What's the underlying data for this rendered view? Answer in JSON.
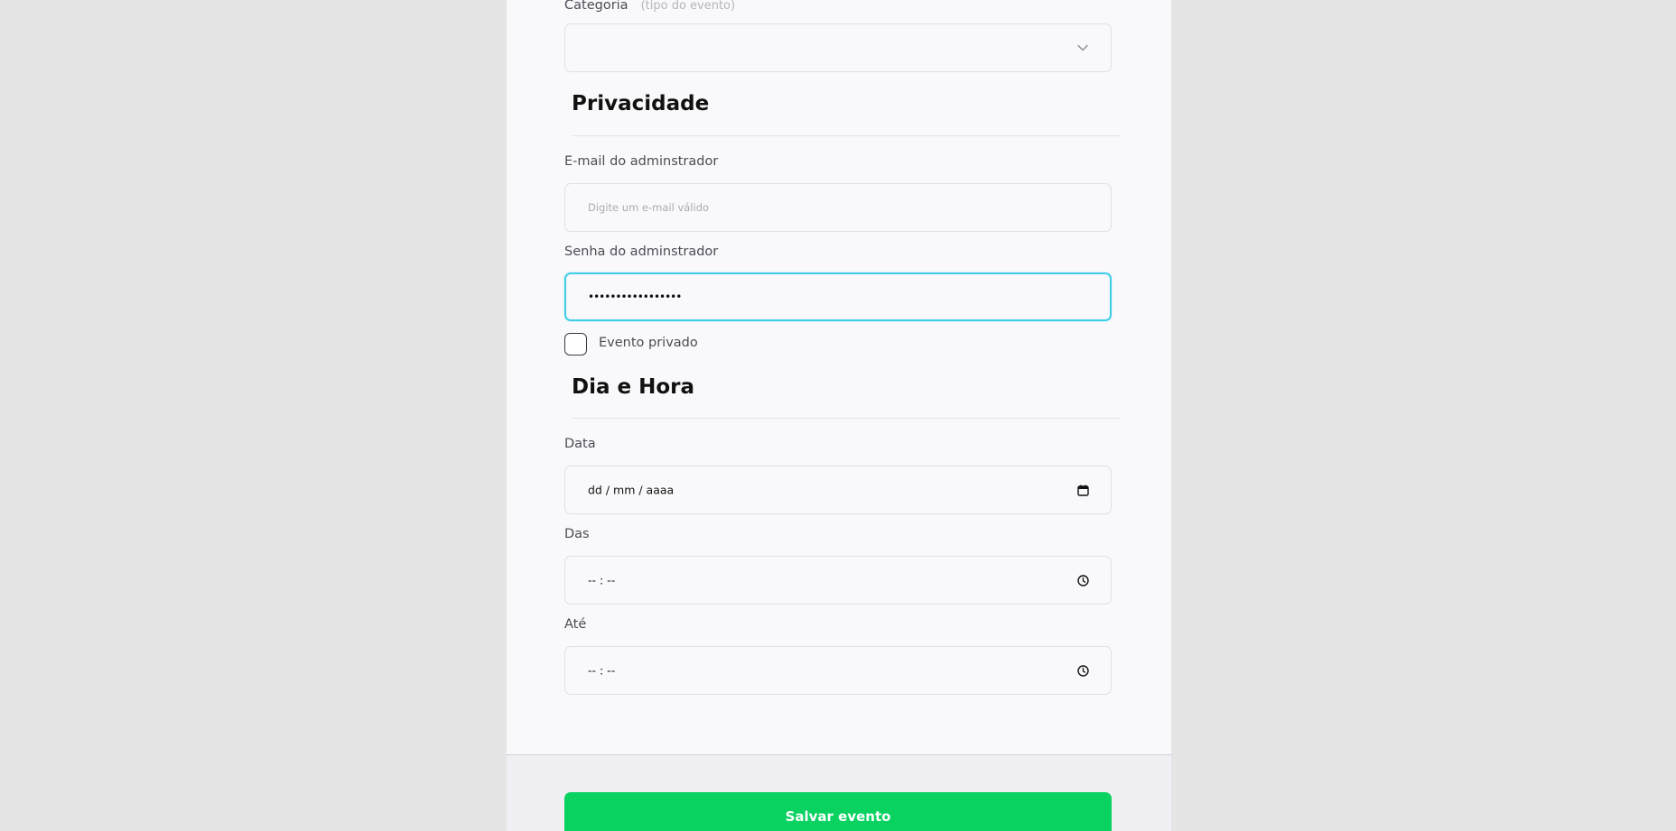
{
  "form": {
    "category": {
      "label": "Categoria",
      "hint": "(tipo do evento)",
      "selected_value": "",
      "icon": "chevron-down-icon"
    },
    "privacy": {
      "title": "Privacidade",
      "admin_email": {
        "label": "E-mail do adminstrador",
        "value": "",
        "placeholder": "Digite um e-mail válido"
      },
      "admin_password": {
        "label": "Senha do adminstrador",
        "value": "•••••••••••••••••"
      },
      "private_event": {
        "label": "Evento privado",
        "checked": false
      }
    },
    "datetime": {
      "title": "Dia e Hora",
      "date": {
        "label": "Data",
        "value": "dd / mm / aaaa",
        "icon": "calendar-icon"
      },
      "from": {
        "label": "Das",
        "value": "-- : --",
        "icon": "clock-icon"
      },
      "to": {
        "label": "Até",
        "value": "-- : --",
        "icon": "clock-icon"
      }
    }
  },
  "footer": {
    "save_label": "Salvar evento"
  },
  "colors": {
    "page_background": "#e5e5e5",
    "panel_background": "#f9f9fb",
    "focus_border": "#3fcde8",
    "primary_button": "#09d261"
  }
}
